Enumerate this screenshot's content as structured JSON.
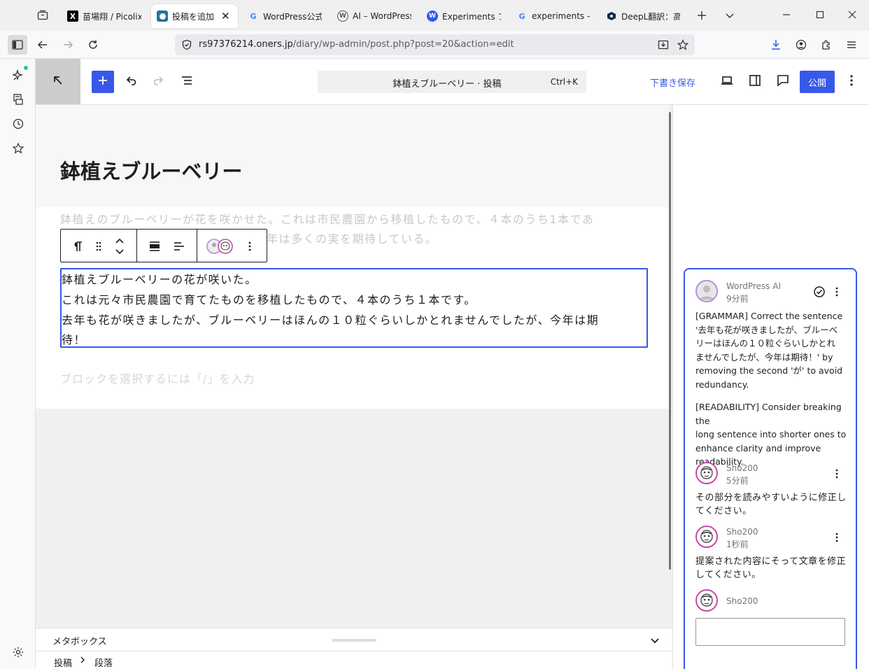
{
  "browser": {
    "tabs": [
      {
        "label": "苗場翔 / Picolix",
        "icon": "x-logo-icon"
      },
      {
        "label": "投稿を追加 ‹",
        "icon": "wp-admin-icon",
        "active": true
      },
      {
        "label": "WordPress公式(",
        "icon": "google-icon"
      },
      {
        "label": "AI – WordPress",
        "icon": "wordpress-icon"
      },
      {
        "label": "Experiments プラ",
        "icon": "wordpress-blue-icon"
      },
      {
        "label": "experiments - G",
        "icon": "google-icon"
      },
      {
        "label": "DeepL翻訳：高",
        "icon": "deepl-icon"
      }
    ],
    "url": {
      "host": "rs97376214.oners.jp",
      "path": "/diary/wp-admin/post.php?post=20&action=edit"
    }
  },
  "editor": {
    "command_title": "鉢植えブルーベリー · 投稿",
    "command_shortcut": "Ctrl+K",
    "save_draft": "下書き保存",
    "publish": "公開",
    "accent_color": "#3858e9"
  },
  "content": {
    "title": "鉢植えブルーベリー",
    "faded_paragraph": {
      "line1": "鉢植えのブルーベリーが花を咲かせた。これは市民農園から移植したもので、４本のうち1本であ",
      "line2_tail": "年は多くの実を期待している。"
    },
    "selected_paragraph": {
      "line1": "鉢植えブルーベリーの花が咲いた。",
      "line2": "これは元々市民農園で育てたものを移植したもので、４本のうち１本です。",
      "line3": "去年も花が咲きましたが、ブルーベリーはほんの１０粒ぐらいしかとれませんでしたが、今年は期",
      "line4": "待！"
    },
    "placeholder": "ブロックを選択するには「/」を入力"
  },
  "metabox": {
    "label": "メタボックス"
  },
  "breadcrumb": {
    "items": [
      "投稿",
      "段落"
    ]
  },
  "comments": {
    "ai": {
      "author": "WordPress AI",
      "time": "9分前",
      "grammar": [
        "[GRAMMAR] Correct the sentence",
        "'去年も花が咲きましたが、ブルーベ",
        "リーはほんの１０粒ぐらいしかとれ",
        "ませんでしたが、今年は期待！' by",
        "removing the second 'が' to avoid",
        "redundancy."
      ],
      "readability": [
        "[READABILITY] Consider breaking the",
        "long sentence into shorter ones to",
        "enhance clarity and improve",
        "readability."
      ]
    },
    "reply1": {
      "author": "Sho200",
      "time": "5分前",
      "lines": [
        "その部分を読みやすいように修正し",
        "てください。"
      ]
    },
    "reply2": {
      "author": "Sho200",
      "time": "1秒前",
      "lines": [
        "提案された内容にそって文章を修正",
        "してください。"
      ]
    },
    "composer": {
      "author": "Sho200"
    }
  }
}
